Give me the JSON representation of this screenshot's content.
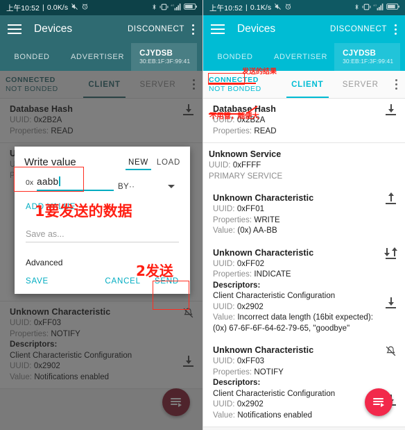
{
  "theme": {
    "cyan": "#00bcd4",
    "cyan_dim": "#2f6b72",
    "statusbar_left": "#0d4148",
    "statusbar_right": "#0f5963",
    "annotation_red": "#ff1f13",
    "fab_red": "#f2294b",
    "fab_red_dim": "#8a2032"
  },
  "left": {
    "statusbar": {
      "time": "上午10:52",
      "separator": "|",
      "net_speed": "0.0K/s",
      "mute_icon": "mute-icon",
      "alarm_icon": "alarm-icon",
      "bluetooth_icon": "bluetooth-icon",
      "vibrate_icon": "vibrate-icon",
      "signal_icon": "signal-4g-icon",
      "battery_icon": "battery-icon",
      "battery_level": "79"
    },
    "appbar": {
      "menu_icon": "hamburger-menu-icon",
      "title": "Devices",
      "action": "DISCONNECT",
      "overflow_icon": "overflow-menu-icon"
    },
    "tabs": [
      {
        "label": "BONDED"
      },
      {
        "label": "ADVERTISER"
      }
    ],
    "device_tab": {
      "name": "CJYDSB",
      "address": "30:EB:1F:3F:99:41",
      "close_icon": "close-icon"
    },
    "subbar": {
      "state_line1": "CONNECTED",
      "state_line2": "NOT BONDED",
      "tabs": [
        {
          "label": "CLIENT",
          "active": true
        },
        {
          "label": "SERVER",
          "active": false
        }
      ],
      "overflow_icon": "overflow-menu-icon"
    },
    "list": [
      {
        "title": "Database Hash",
        "uuid_label": "UUID:",
        "uuid": "0x2B2A",
        "props_label": "Properties:",
        "props": "READ",
        "action_icon": "download-icon"
      },
      {
        "title": "Unknown Characteristic",
        "uuid_label": "UUID:",
        "uuid": "0xFF03",
        "props_label": "Properties:",
        "props": "NOTIFY",
        "descriptors_label": "Descriptors:",
        "descriptor_name": "Client Characteristic Configuration",
        "descriptor_uuid_label": "UUID:",
        "descriptor_uuid": "0x2902",
        "value_label": "Value:",
        "value": "Notifications enabled",
        "action_icon": "notification-off-icon",
        "descriptor_action_icon": "download-icon"
      }
    ],
    "fab": {
      "icon": "log-list-icon"
    },
    "dialog": {
      "title": "Write value",
      "modes": [
        {
          "label": "NEW",
          "active": true
        },
        {
          "label": "LOAD",
          "active": false
        }
      ],
      "hex_prefix": "0x",
      "hex_value": "aabb",
      "type_select": "BY··",
      "type_select_caret": "chevron-down-icon",
      "add_value": "ADD VALUE",
      "save_as_placeholder": "Save as...",
      "advanced": "Advanced",
      "buttons": {
        "save": "SAVE",
        "cancel": "CANCEL",
        "send": "SEND"
      }
    },
    "annotations": [
      {
        "text": "1要发送的数据"
      },
      {
        "text": "2发送"
      }
    ]
  },
  "right": {
    "statusbar": {
      "time": "上午10:52",
      "separator": "|",
      "net_speed": "0.1K/s",
      "mute_icon": "mute-icon",
      "alarm_icon": "alarm-icon",
      "bluetooth_icon": "bluetooth-icon",
      "vibrate_icon": "vibrate-icon",
      "signal_icon": "signal-4g-icon",
      "battery_icon": "battery-icon",
      "battery_level": "79"
    },
    "appbar": {
      "menu_icon": "hamburger-menu-icon",
      "title": "Devices",
      "action": "DISCONNECT",
      "overflow_icon": "overflow-menu-icon"
    },
    "tabs": [
      {
        "label": "BONDED"
      },
      {
        "label": "ADVERTISER"
      }
    ],
    "device_tab": {
      "name": "CJYDSB",
      "address": "30:EB:1F:3F:99:41",
      "close_icon": "close-icon"
    },
    "subbar": {
      "state_line1": "CONNECTED",
      "state_line2": "NOT BONDED",
      "tabs": [
        {
          "label": "CLIENT",
          "active": true
        },
        {
          "label": "SERVER",
          "active": false
        }
      ],
      "overflow_icon": "overflow-menu-icon"
    },
    "list": [
      {
        "title": "Database Hash",
        "uuid_label": "UUID:",
        "uuid": "0x2B2A",
        "props_label": "Properties:",
        "props": "READ",
        "action_icon": "download-icon"
      },
      {
        "service_name": "Unknown Service",
        "uuid_label": "UUID:",
        "uuid": "0xFFFF",
        "service_type": "PRIMARY SERVICE",
        "characteristics": [
          {
            "title": "Unknown Characteristic",
            "uuid_label": "UUID:",
            "uuid": "0xFF01",
            "props_label": "Properties:",
            "props": "WRITE",
            "value_label": "Value:",
            "value": "(0x) AA-BB",
            "action_icon": "upload-icon"
          },
          {
            "title": "Unknown Characteristic",
            "uuid_label": "UUID:",
            "uuid": "0xFF02",
            "props_label": "Properties:",
            "props": "INDICATE",
            "descriptors_label": "Descriptors:",
            "descriptor_name": "Client Characteristic Configuration",
            "descriptor_uuid_label": "UUID:",
            "descriptor_uuid": "0x2902",
            "value_label": "Value:",
            "value": "Incorrect data length (16bit expected): (0x) 67-6F-6F-64-62-79-65, \"goodbye\"",
            "action_icon": "download-upload-icon",
            "descriptor_action_icon": "download-icon"
          },
          {
            "title": "Unknown Characteristic",
            "uuid_label": "UUID:",
            "uuid": "0xFF03",
            "props_label": "Properties:",
            "props": "NOTIFY",
            "descriptors_label": "Descriptors:",
            "descriptor_name": "Client Characteristic Configuration",
            "descriptor_uuid_label": "UUID:",
            "descriptor_uuid": "0x2902",
            "value_label": "Value:",
            "value": "Notifications enabled",
            "action_icon": "notification-off-icon",
            "descriptor_action_icon": "download-icon"
          }
        ]
      }
    ],
    "fab": {
      "icon": "log-list-icon"
    },
    "annotations": [
      {
        "text": "发送的结果"
      },
      {
        "text": "不用管，随便大"
      }
    ]
  }
}
